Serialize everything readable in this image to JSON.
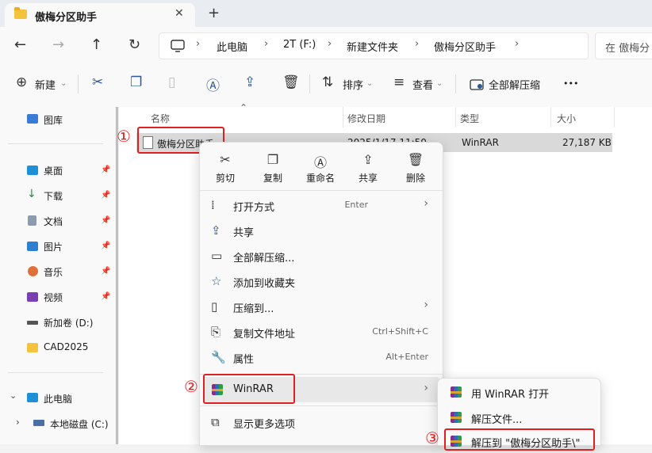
{
  "tab": {
    "title": "傲梅分区助手",
    "close": "✕",
    "new": "+"
  },
  "nav": {
    "back": "←",
    "forward": "→",
    "up": "↑",
    "refresh": "↻"
  },
  "breadcrumbs": [
    "此电脑",
    "2T (F:)",
    "新建文件夹",
    "傲梅分区助手"
  ],
  "search": {
    "placeholder": "在 傲梅分"
  },
  "toolbar": {
    "new": "新建",
    "sort": "排序",
    "view": "查看",
    "extract_all": "全部解压缩",
    "more": "•••"
  },
  "sidebar": {
    "top": [
      {
        "label": "图库"
      }
    ],
    "quick": [
      {
        "label": "桌面"
      },
      {
        "label": "下载"
      },
      {
        "label": "文档"
      },
      {
        "label": "图片"
      },
      {
        "label": "音乐"
      },
      {
        "label": "视频"
      },
      {
        "label": "新加卷 (D:)"
      },
      {
        "label": "CAD2025"
      }
    ],
    "pc": {
      "label": "此电脑",
      "children": [
        {
          "label": "本地磁盘 (C:)"
        }
      ]
    }
  },
  "columns": {
    "name": "名称",
    "modified": "修改日期",
    "type": "类型",
    "size": "大小"
  },
  "file": {
    "name": "傲梅分区助手",
    "modified": "2025/1/17 11:50",
    "type": "WinRAR",
    "size": "27,187 KB"
  },
  "context_menu": {
    "quick_actions": [
      {
        "label": "剪切",
        "icon": "scissors-icon"
      },
      {
        "label": "复制",
        "icon": "copy-icon"
      },
      {
        "label": "重命名",
        "icon": "rename-icon"
      },
      {
        "label": "共享",
        "icon": "share-icon"
      },
      {
        "label": "删除",
        "icon": "trash-icon"
      }
    ],
    "items": [
      {
        "label": "打开方式",
        "shortcut": "Enter",
        "arrow": "›"
      },
      {
        "label": "共享"
      },
      {
        "label": "全部解压缩..."
      },
      {
        "label": "添加到收藏夹"
      },
      {
        "label": "压缩到...",
        "arrow": "›"
      },
      {
        "label": "复制文件地址",
        "shortcut": "Ctrl+Shift+C"
      },
      {
        "label": "属性",
        "shortcut": "Alt+Enter"
      },
      {
        "label": "WinRAR",
        "arrow": "›"
      },
      {
        "label": "显示更多选项"
      }
    ]
  },
  "submenu": {
    "items": [
      {
        "label": "用 WinRAR 打开"
      },
      {
        "label": "解压文件..."
      },
      {
        "label": "解压到 \"傲梅分区助手\\\""
      }
    ]
  },
  "annotations": [
    "①",
    "②",
    "③"
  ],
  "colors": {
    "highlight": "#e02020",
    "folder": "#f3c33d",
    "accent": "#2b5797"
  }
}
